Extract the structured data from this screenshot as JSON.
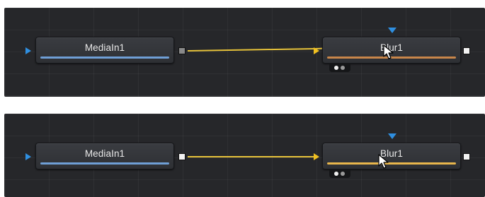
{
  "panels": [
    {
      "media_node": {
        "label": "MediaIn1"
      },
      "blur_node": {
        "label": "Blur1"
      }
    },
    {
      "media_node": {
        "label": "MediaIn1"
      },
      "blur_node": {
        "label": "Blur1"
      }
    }
  ],
  "colors": {
    "background": "#26272a",
    "wire": "#e6c23a",
    "input_triangle": "#2f8fe0",
    "media_bar": "#6f9fd6",
    "blur_bar_top": "#c8864a",
    "blur_bar_bottom": "#e8b64c"
  }
}
